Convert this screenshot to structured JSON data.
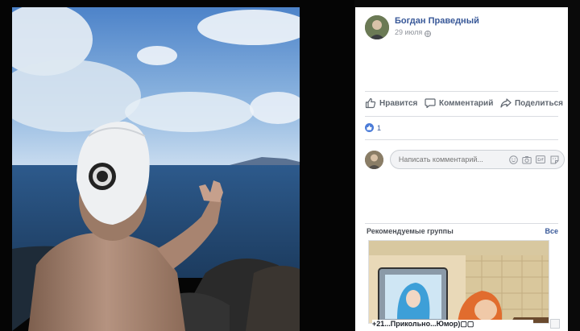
{
  "post": {
    "author_name": "Богдан Праведный",
    "date": "29 июля"
  },
  "actions": {
    "like_label": "Нравится",
    "comment_label": "Комментарий",
    "share_label": "Поделиться"
  },
  "reactions": {
    "count": "1"
  },
  "comment": {
    "placeholder": "Написать комментарий..."
  },
  "groups": {
    "title": "Рекомендуемые группы",
    "see_all": "Все",
    "first_group_name": "+21...Прикольно...Юмор)▢▢"
  },
  "colors": {
    "link_blue": "#385898",
    "like_blue": "#4a7bd8"
  },
  "icons": [
    "globe-icon",
    "like-icon",
    "comment-icon",
    "share-icon",
    "smiley-icon",
    "camera-icon",
    "gif-icon",
    "sticker-icon"
  ]
}
